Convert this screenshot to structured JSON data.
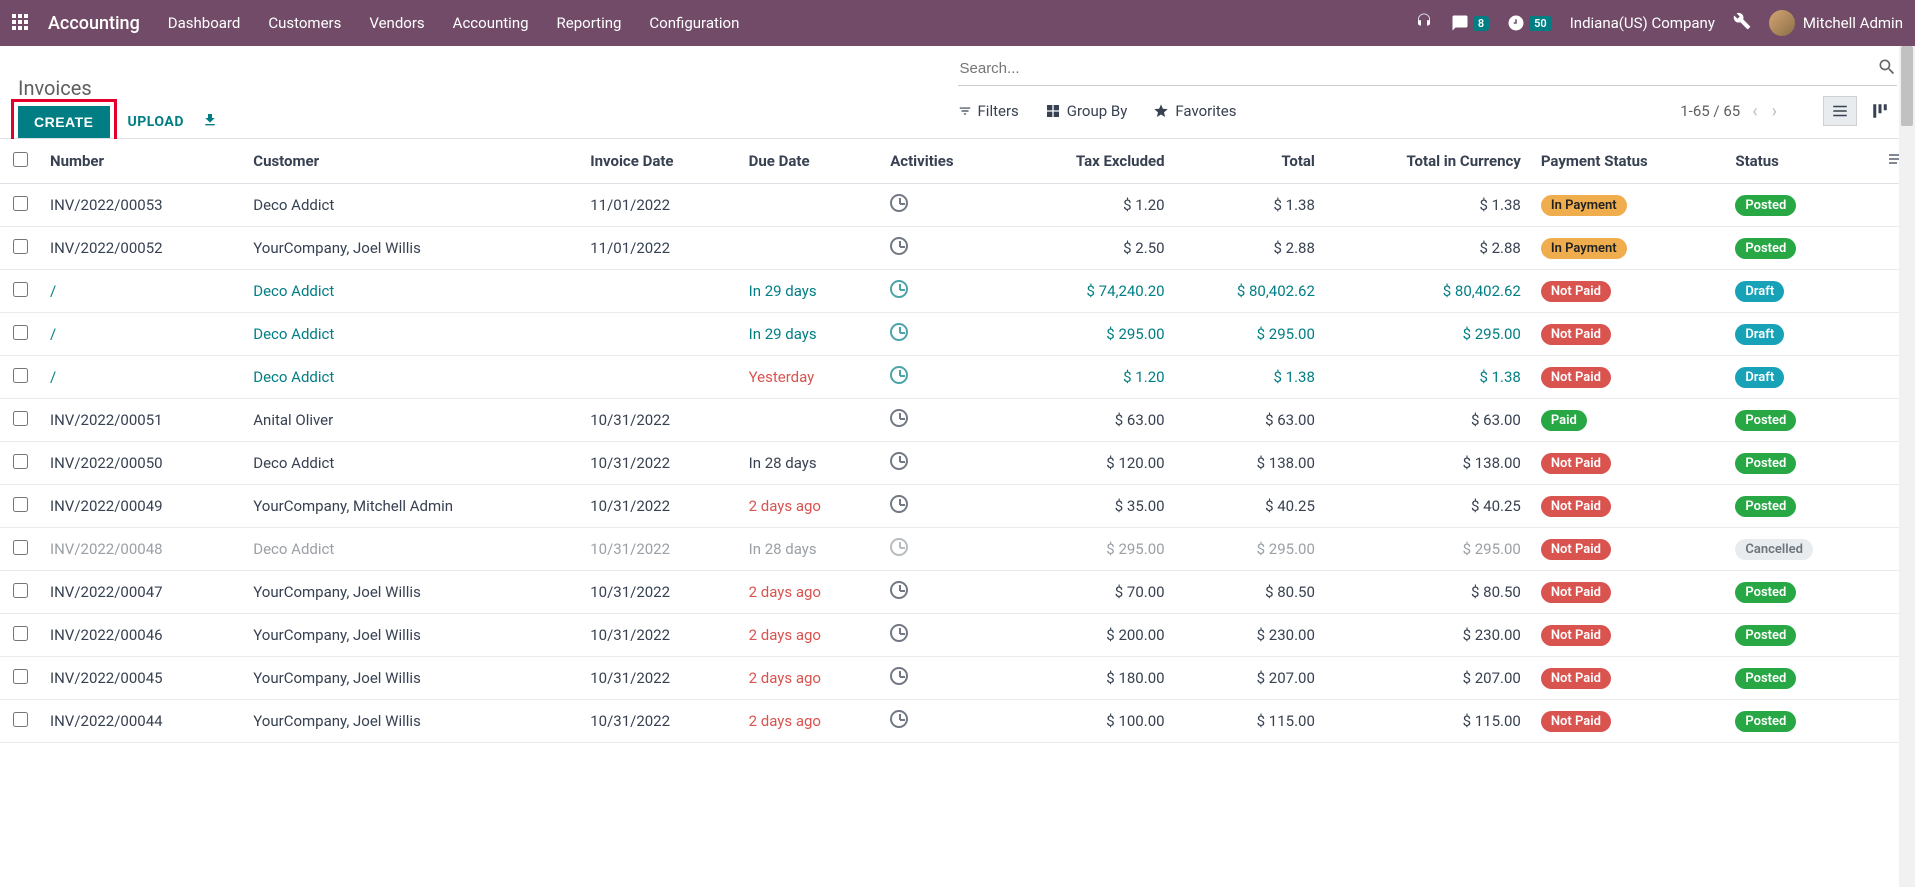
{
  "topbar": {
    "app_name": "Accounting",
    "nav": [
      "Dashboard",
      "Customers",
      "Vendors",
      "Accounting",
      "Reporting",
      "Configuration"
    ],
    "messages_count": "8",
    "activities_count": "50",
    "company": "Indiana(US) Company",
    "user": "Mitchell Admin"
  },
  "breadcrumb": "Invoices",
  "buttons": {
    "create": "CREATE",
    "upload": "UPLOAD"
  },
  "search": {
    "placeholder": "Search..."
  },
  "toolbar": {
    "filters": "Filters",
    "group_by": "Group By",
    "favorites": "Favorites",
    "pager": "1-65 / 65"
  },
  "columns": {
    "number": "Number",
    "customer": "Customer",
    "invoice_date": "Invoice Date",
    "due_date": "Due Date",
    "activities": "Activities",
    "tax_excluded": "Tax Excluded",
    "total": "Total",
    "total_currency": "Total in Currency",
    "payment_status": "Payment Status",
    "status": "Status"
  },
  "rows": [
    {
      "number": "INV/2022/00053",
      "customer": "Deco Addict",
      "invoice_date": "11/01/2022",
      "due_date": "",
      "due_class": "",
      "tax_excluded": "$ 1.20",
      "total": "$ 1.38",
      "total_currency": "$ 1.38",
      "payment_status": "In Payment",
      "payment_class": "in-payment",
      "status": "Posted",
      "status_class": "posted",
      "row_class": ""
    },
    {
      "number": "INV/2022/00052",
      "customer": "YourCompany, Joel Willis",
      "invoice_date": "11/01/2022",
      "due_date": "",
      "due_class": "",
      "tax_excluded": "$ 2.50",
      "total": "$ 2.88",
      "total_currency": "$ 2.88",
      "payment_status": "In Payment",
      "payment_class": "in-payment",
      "status": "Posted",
      "status_class": "posted",
      "row_class": ""
    },
    {
      "number": "/",
      "customer": "Deco Addict",
      "invoice_date": "",
      "due_date": "In 29 days",
      "due_class": "",
      "tax_excluded": "$ 74,240.20",
      "total": "$ 80,402.62",
      "total_currency": "$ 80,402.62",
      "payment_status": "Not Paid",
      "payment_class": "not-paid",
      "status": "Draft",
      "status_class": "draft",
      "row_class": "draft-row"
    },
    {
      "number": "/",
      "customer": "Deco Addict",
      "invoice_date": "",
      "due_date": "In 29 days",
      "due_class": "",
      "tax_excluded": "$ 295.00",
      "total": "$ 295.00",
      "total_currency": "$ 295.00",
      "payment_status": "Not Paid",
      "payment_class": "not-paid",
      "status": "Draft",
      "status_class": "draft",
      "row_class": "draft-row"
    },
    {
      "number": "/",
      "customer": "Deco Addict",
      "invoice_date": "",
      "due_date": "Yesterday",
      "due_class": "overdue",
      "tax_excluded": "$ 1.20",
      "total": "$ 1.38",
      "total_currency": "$ 1.38",
      "payment_status": "Not Paid",
      "payment_class": "not-paid",
      "status": "Draft",
      "status_class": "draft",
      "row_class": "draft-row"
    },
    {
      "number": "INV/2022/00051",
      "customer": "Anital Oliver",
      "invoice_date": "10/31/2022",
      "due_date": "",
      "due_class": "",
      "tax_excluded": "$ 63.00",
      "total": "$ 63.00",
      "total_currency": "$ 63.00",
      "payment_status": "Paid",
      "payment_class": "paid",
      "status": "Posted",
      "status_class": "posted",
      "row_class": ""
    },
    {
      "number": "INV/2022/00050",
      "customer": "Deco Addict",
      "invoice_date": "10/31/2022",
      "due_date": "In 28 days",
      "due_class": "",
      "tax_excluded": "$ 120.00",
      "total": "$ 138.00",
      "total_currency": "$ 138.00",
      "payment_status": "Not Paid",
      "payment_class": "not-paid",
      "status": "Posted",
      "status_class": "posted",
      "row_class": ""
    },
    {
      "number": "INV/2022/00049",
      "customer": "YourCompany, Mitchell Admin",
      "invoice_date": "10/31/2022",
      "due_date": "2 days ago",
      "due_class": "overdue",
      "tax_excluded": "$ 35.00",
      "total": "$ 40.25",
      "total_currency": "$ 40.25",
      "payment_status": "Not Paid",
      "payment_class": "not-paid",
      "status": "Posted",
      "status_class": "posted",
      "row_class": ""
    },
    {
      "number": "INV/2022/00048",
      "customer": "Deco Addict",
      "invoice_date": "10/31/2022",
      "due_date": "In 28 days",
      "due_class": "",
      "tax_excluded": "$ 295.00",
      "total": "$ 295.00",
      "total_currency": "$ 295.00",
      "payment_status": "Not Paid",
      "payment_class": "not-paid",
      "status": "Cancelled",
      "status_class": "cancelled",
      "row_class": "muted-row"
    },
    {
      "number": "INV/2022/00047",
      "customer": "YourCompany, Joel Willis",
      "invoice_date": "10/31/2022",
      "due_date": "2 days ago",
      "due_class": "overdue",
      "tax_excluded": "$ 70.00",
      "total": "$ 80.50",
      "total_currency": "$ 80.50",
      "payment_status": "Not Paid",
      "payment_class": "not-paid",
      "status": "Posted",
      "status_class": "posted",
      "row_class": ""
    },
    {
      "number": "INV/2022/00046",
      "customer": "YourCompany, Joel Willis",
      "invoice_date": "10/31/2022",
      "due_date": "2 days ago",
      "due_class": "overdue",
      "tax_excluded": "$ 200.00",
      "total": "$ 230.00",
      "total_currency": "$ 230.00",
      "payment_status": "Not Paid",
      "payment_class": "not-paid",
      "status": "Posted",
      "status_class": "posted",
      "row_class": ""
    },
    {
      "number": "INV/2022/00045",
      "customer": "YourCompany, Joel Willis",
      "invoice_date": "10/31/2022",
      "due_date": "2 days ago",
      "due_class": "overdue",
      "tax_excluded": "$ 180.00",
      "total": "$ 207.00",
      "total_currency": "$ 207.00",
      "payment_status": "Not Paid",
      "payment_class": "not-paid",
      "status": "Posted",
      "status_class": "posted",
      "row_class": ""
    },
    {
      "number": "INV/2022/00044",
      "customer": "YourCompany, Joel Willis",
      "invoice_date": "10/31/2022",
      "due_date": "2 days ago",
      "due_class": "overdue",
      "tax_excluded": "$ 100.00",
      "total": "$ 115.00",
      "total_currency": "$ 115.00",
      "payment_status": "Not Paid",
      "payment_class": "not-paid",
      "status": "Posted",
      "status_class": "posted",
      "row_class": ""
    }
  ]
}
